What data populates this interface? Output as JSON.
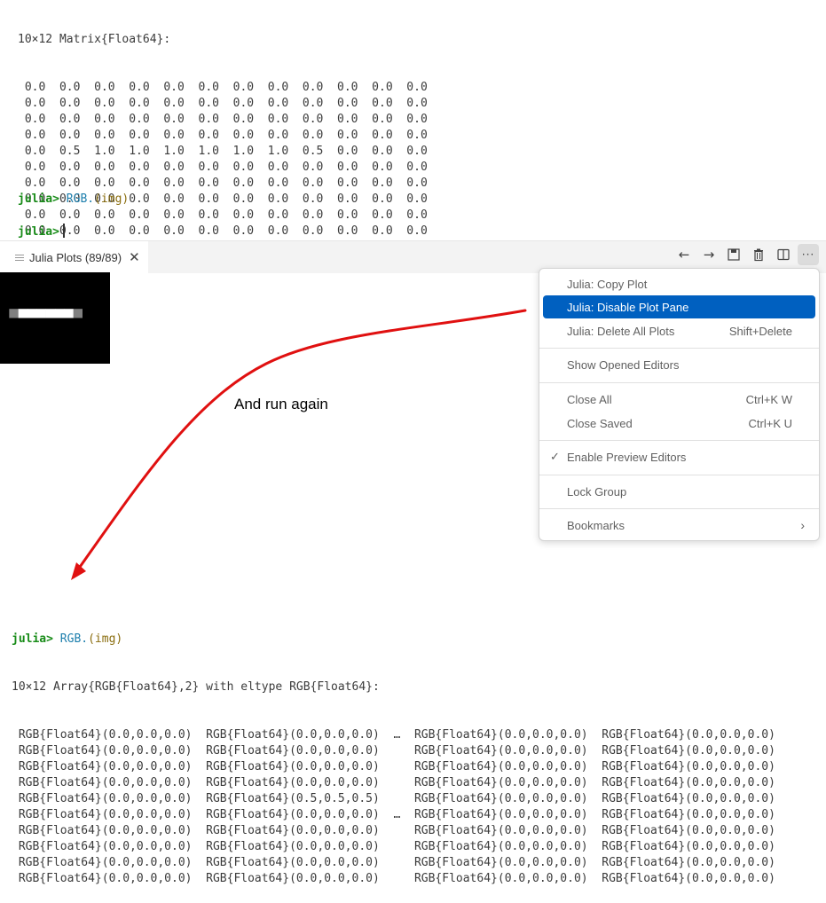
{
  "top_repl": {
    "header": "10×12 Matrix{Float64}:",
    "matrix_rows": [
      [
        0.0,
        0.0,
        0.0,
        0.0,
        0.0,
        0.0,
        0.0,
        0.0,
        0.0,
        0.0,
        0.0,
        0.0
      ],
      [
        0.0,
        0.0,
        0.0,
        0.0,
        0.0,
        0.0,
        0.0,
        0.0,
        0.0,
        0.0,
        0.0,
        0.0
      ],
      [
        0.0,
        0.0,
        0.0,
        0.0,
        0.0,
        0.0,
        0.0,
        0.0,
        0.0,
        0.0,
        0.0,
        0.0
      ],
      [
        0.0,
        0.0,
        0.0,
        0.0,
        0.0,
        0.0,
        0.0,
        0.0,
        0.0,
        0.0,
        0.0,
        0.0
      ],
      [
        0.0,
        0.5,
        1.0,
        1.0,
        1.0,
        1.0,
        1.0,
        1.0,
        0.5,
        0.0,
        0.0,
        0.0
      ],
      [
        0.0,
        0.0,
        0.0,
        0.0,
        0.0,
        0.0,
        0.0,
        0.0,
        0.0,
        0.0,
        0.0,
        0.0
      ],
      [
        0.0,
        0.0,
        0.0,
        0.0,
        0.0,
        0.0,
        0.0,
        0.0,
        0.0,
        0.0,
        0.0,
        0.0
      ],
      [
        0.0,
        0.0,
        0.0,
        0.0,
        0.0,
        0.0,
        0.0,
        0.0,
        0.0,
        0.0,
        0.0,
        0.0
      ],
      [
        0.0,
        0.0,
        0.0,
        0.0,
        0.0,
        0.0,
        0.0,
        0.0,
        0.0,
        0.0,
        0.0,
        0.0
      ],
      [
        0.0,
        0.0,
        0.0,
        0.0,
        0.0,
        0.0,
        0.0,
        0.0,
        0.0,
        0.0,
        0.0,
        0.0
      ]
    ],
    "prompt": "julia>",
    "command_func": "RGB.",
    "command_args": "(img)"
  },
  "plot_pane": {
    "tab_label": "Julia Plots (89/89)",
    "tab_icon": "lines-icon",
    "close_icon": "close-icon",
    "toolbar": [
      {
        "name": "back-button",
        "icon": "←"
      },
      {
        "name": "forward-button",
        "icon": "→"
      },
      {
        "name": "save-plot-button",
        "icon": "💾"
      },
      {
        "name": "delete-plot-button",
        "icon": "🗑"
      },
      {
        "name": "split-editor-button",
        "icon": "◫"
      },
      {
        "name": "more-actions-button",
        "icon": "···"
      }
    ]
  },
  "context_menu": {
    "items": [
      {
        "label": "Julia: Copy Plot",
        "shortcut": "",
        "selected": false,
        "checked": false
      },
      {
        "label": "Julia: Disable Plot Pane",
        "shortcut": "",
        "selected": true,
        "checked": false
      },
      {
        "label": "Julia: Delete All Plots",
        "shortcut": "Shift+Delete",
        "selected": false,
        "checked": false
      },
      {
        "label": "Show Opened Editors",
        "shortcut": "",
        "selected": false,
        "checked": false
      },
      {
        "label": "Close All",
        "shortcut": "Ctrl+K W",
        "selected": false,
        "checked": false
      },
      {
        "label": "Close Saved",
        "shortcut": "Ctrl+K U",
        "selected": false,
        "checked": false
      },
      {
        "label": "Enable Preview Editors",
        "shortcut": "",
        "selected": false,
        "checked": true
      },
      {
        "label": "Lock Group",
        "shortcut": "",
        "selected": false,
        "checked": false
      },
      {
        "label": "Bookmarks",
        "shortcut": "",
        "selected": false,
        "checked": false,
        "submenu": true
      }
    ],
    "check_glyph": "✓",
    "submenu_glyph": "›"
  },
  "annotation": {
    "text": "And run again",
    "color": "#e01010"
  },
  "bottom_repl": {
    "prompt": "julia>",
    "command_func": "RGB.",
    "command_args": "(img)",
    "header": "10×12 Array{RGB{Float64},2} with eltype RGB{Float64}:",
    "ellipsis": "…",
    "ellipsis_rows": [
      0,
      5
    ],
    "rows": [
      [
        "RGB{Float64}(0.0,0.0,0.0)",
        "RGB{Float64}(0.0,0.0,0.0)",
        "RGB{Float64}(0.0,0.0,0.0)",
        "RGB{Float64}(0.0,0.0,0.0)"
      ],
      [
        "RGB{Float64}(0.0,0.0,0.0)",
        "RGB{Float64}(0.0,0.0,0.0)",
        "RGB{Float64}(0.0,0.0,0.0)",
        "RGB{Float64}(0.0,0.0,0.0)"
      ],
      [
        "RGB{Float64}(0.0,0.0,0.0)",
        "RGB{Float64}(0.0,0.0,0.0)",
        "RGB{Float64}(0.0,0.0,0.0)",
        "RGB{Float64}(0.0,0.0,0.0)"
      ],
      [
        "RGB{Float64}(0.0,0.0,0.0)",
        "RGB{Float64}(0.0,0.0,0.0)",
        "RGB{Float64}(0.0,0.0,0.0)",
        "RGB{Float64}(0.0,0.0,0.0)"
      ],
      [
        "RGB{Float64}(0.0,0.0,0.0)",
        "RGB{Float64}(0.5,0.5,0.5)",
        "RGB{Float64}(0.0,0.0,0.0)",
        "RGB{Float64}(0.0,0.0,0.0)"
      ],
      [
        "RGB{Float64}(0.0,0.0,0.0)",
        "RGB{Float64}(0.0,0.0,0.0)",
        "RGB{Float64}(0.0,0.0,0.0)",
        "RGB{Float64}(0.0,0.0,0.0)"
      ],
      [
        "RGB{Float64}(0.0,0.0,0.0)",
        "RGB{Float64}(0.0,0.0,0.0)",
        "RGB{Float64}(0.0,0.0,0.0)",
        "RGB{Float64}(0.0,0.0,0.0)"
      ],
      [
        "RGB{Float64}(0.0,0.0,0.0)",
        "RGB{Float64}(0.0,0.0,0.0)",
        "RGB{Float64}(0.0,0.0,0.0)",
        "RGB{Float64}(0.0,0.0,0.0)"
      ],
      [
        "RGB{Float64}(0.0,0.0,0.0)",
        "RGB{Float64}(0.0,0.0,0.0)",
        "RGB{Float64}(0.0,0.0,0.0)",
        "RGB{Float64}(0.0,0.0,0.0)"
      ],
      [
        "RGB{Float64}(0.0,0.0,0.0)",
        "RGB{Float64}(0.0,0.0,0.0)",
        "RGB{Float64}(0.0,0.0,0.0)",
        "RGB{Float64}(0.0,0.0,0.0)"
      ]
    ]
  }
}
